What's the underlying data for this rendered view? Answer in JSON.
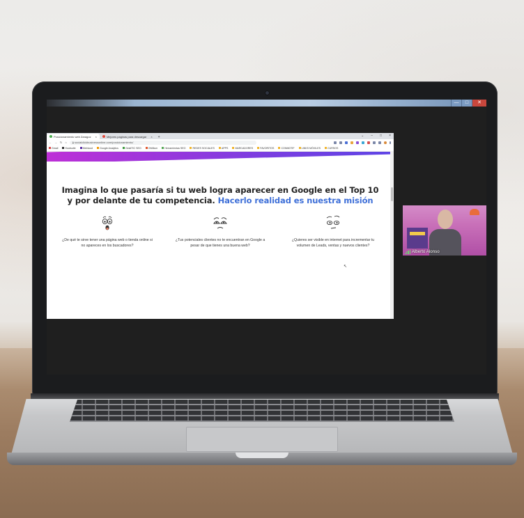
{
  "host_window": {
    "controls": {
      "minimize": "—",
      "maximize": "□",
      "close": "✕"
    }
  },
  "browser": {
    "tabs": [
      {
        "label": "Posicionamiento web Zaragoz",
        "active": true
      },
      {
        "label": "Mejores paginas para descargar",
        "active": false
      }
    ],
    "new_tab": "+",
    "url": "socialclickbusinessonline.com/posicionamiento/",
    "bookmarks": [
      "Gmail",
      "Hootsuite",
      "Metricool",
      "Google Analytics",
      "GestiTIC SEO",
      "OhMium",
      "Herramientas SEO",
      "REDES SOCIALES",
      "APPS",
      "MARCADORES",
      "FAVORITOS",
      "CONMOTIF",
      "LINKS MÓVILES",
      "CURSOS"
    ]
  },
  "page": {
    "headline_line1": "Imagina lo que pasaría si tu web logra aparecer en Google en el Top 10",
    "headline_line2": "y por delante de tu competencia.",
    "headline_accent": "Hacerlo realidad es nuestra misión",
    "features": [
      {
        "icon": "shocked-face-icon",
        "text": "¿De qué te sirve tener una página web o tienda online si no apareces en los buscadores?"
      },
      {
        "icon": "worried-face-icon",
        "text": "¿Tus potenciales clientes no te encuentran en Google a pesar de que tienes una buena web?"
      },
      {
        "icon": "skeptical-face-icon",
        "text": "¿Quieres ser visible en internet para incrementar tu volumen de Leads, ventas y nuevos clientes?"
      }
    ]
  },
  "webcam": {
    "participant_name": "Alberto Alonso"
  }
}
